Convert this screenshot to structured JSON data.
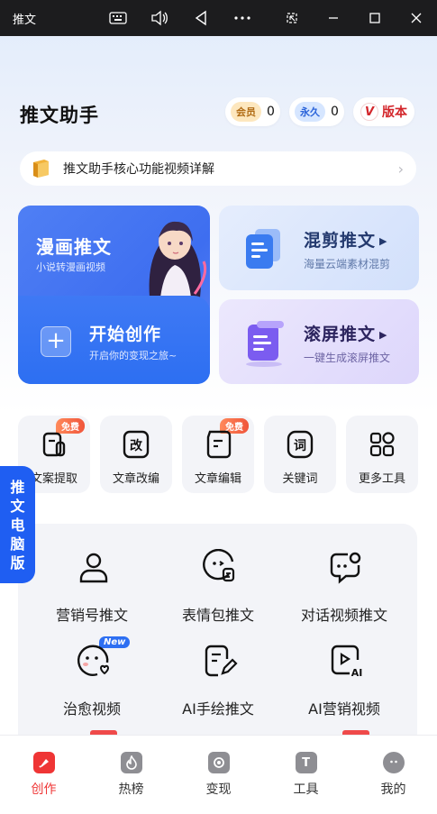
{
  "window": {
    "title": "推文"
  },
  "header": {
    "title": "推文助手",
    "vip_tag": "会员",
    "vip_count": "0",
    "forever_tag": "永久",
    "forever_count": "0",
    "v_badge": "V",
    "version_label": "版本"
  },
  "notice": {
    "text": "推文助手核心功能视频详解"
  },
  "cards": {
    "comic": {
      "title": "漫画推文",
      "subtitle": "小说转漫画视频"
    },
    "start": {
      "title": "开始创作",
      "subtitle": "开启你的变现之旅~"
    },
    "mix": {
      "title": "混剪推文",
      "subtitle": "海量云端素材混剪"
    },
    "scroll": {
      "title": "滚屏推文",
      "subtitle": "一键生成滚屏推文"
    }
  },
  "tools": [
    {
      "label": "文案提取",
      "badge": "免费",
      "icon": "copy-extract-icon"
    },
    {
      "label": "文章改编",
      "glyph": "改",
      "icon": "rewrite-icon"
    },
    {
      "label": "文章编辑",
      "badge": "免费",
      "icon": "edit-doc-icon"
    },
    {
      "label": "关键词",
      "glyph": "词",
      "icon": "keyword-icon"
    },
    {
      "label": "更多工具",
      "icon": "grid-icon"
    }
  ],
  "side_tab": {
    "chars": [
      "推",
      "文",
      "电",
      "脑",
      "版"
    ]
  },
  "features": [
    {
      "label": "营销号推文",
      "icon": "person-icon"
    },
    {
      "label": "表情包推文",
      "icon": "emoji-icon"
    },
    {
      "label": "对话视频推文",
      "icon": "chat-icon"
    },
    {
      "label": "治愈视频",
      "icon": "heal-face-icon",
      "badge": "New"
    },
    {
      "label": "AI手绘推文",
      "icon": "pen-doc-icon"
    },
    {
      "label": "AI营销视频",
      "icon": "ai-video-icon",
      "glyph": "AI"
    }
  ],
  "nav": {
    "items": [
      {
        "label": "创作",
        "active": true
      },
      {
        "label": "热榜"
      },
      {
        "label": "变现"
      },
      {
        "label": "工具"
      },
      {
        "label": "我的"
      }
    ]
  },
  "colors": {
    "primary": "#2d6ff2",
    "accent_red": "#ef3535",
    "titlebar": "#1c1c1e"
  }
}
